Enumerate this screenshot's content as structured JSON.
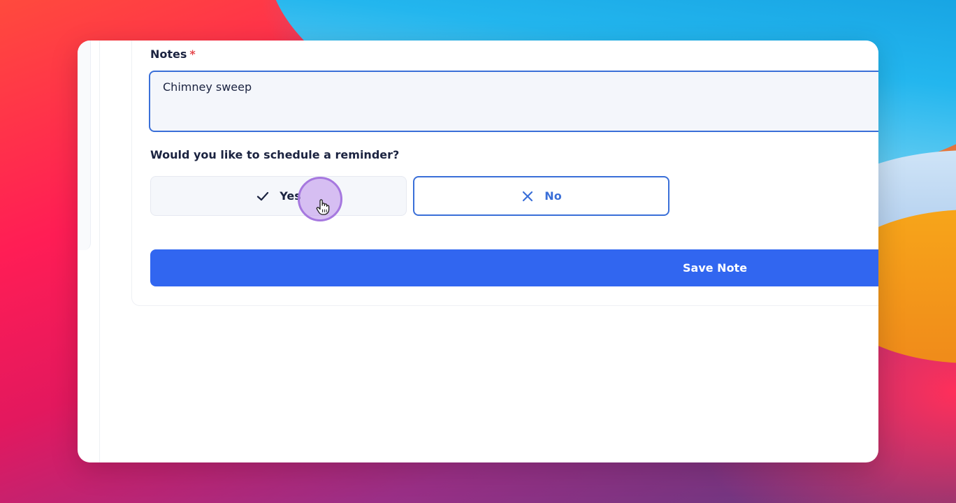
{
  "form": {
    "notes_label": "Notes",
    "required_mark": "*",
    "notes_value": "Chimney sweep",
    "reminder_question": "Would you like to schedule a reminder?",
    "yes_label": "Yes",
    "no_label": "No",
    "save_label": "Save Note"
  },
  "icons": {
    "yes": "check-icon",
    "no": "close-icon",
    "pointer": "hand-pointer-icon"
  },
  "colors": {
    "primary": "#3166f0",
    "accent_border": "#3a6fd8",
    "required": "#e5484d",
    "text": "#1b2340",
    "cursor_highlight": "#a678df"
  }
}
